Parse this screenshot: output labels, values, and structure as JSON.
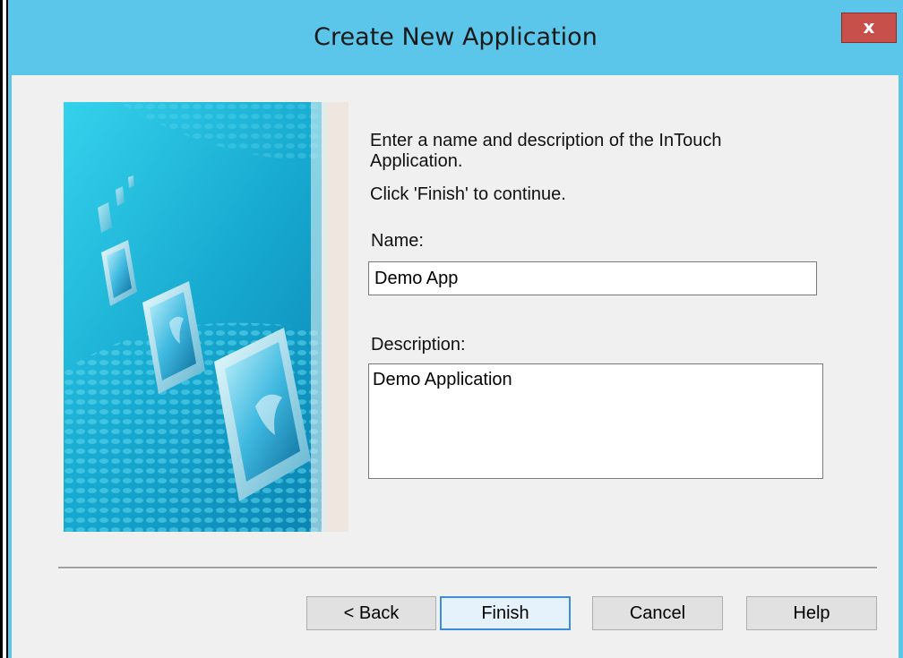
{
  "window": {
    "title": "Create New Application",
    "close_label": "x"
  },
  "intro": {
    "line1": "Enter a name and description of the InTouch Application.",
    "line2": "Click 'Finish' to continue."
  },
  "name": {
    "label": "Name:",
    "value": "Demo App"
  },
  "description": {
    "label": "Description:",
    "value": "Demo Application"
  },
  "buttons": {
    "back": "< Back",
    "finish": "Finish",
    "cancel": "Cancel",
    "help": "Help"
  },
  "colors": {
    "titlebar": "#5cc6ea",
    "close_button": "#c7504a",
    "dialog_background": "#f0f0f0",
    "default_button_border": "#3c8ddc"
  },
  "icons": {
    "close": "close-icon",
    "banner": "wizard-banner-image"
  }
}
